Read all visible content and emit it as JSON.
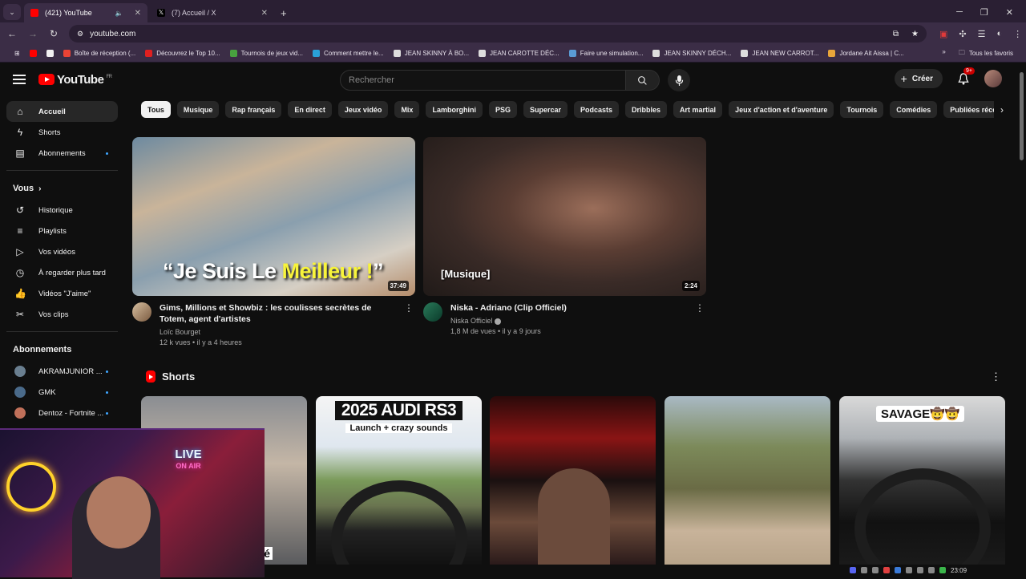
{
  "browser": {
    "tabs": [
      {
        "label": "(421) YouTube",
        "active": true,
        "color": "#ff0000"
      },
      {
        "label": "(7) Accueil / X",
        "active": false,
        "color": "#000000"
      }
    ],
    "url": "youtube.com",
    "bookmarks": [
      {
        "label": "Boîte de réception (...",
        "color": "#ea4335"
      },
      {
        "label": "Découvrez le Top 10...",
        "color": "#e02020"
      },
      {
        "label": "Tournois de jeux vid...",
        "color": "#48a23f"
      },
      {
        "label": "Comment mettre le...",
        "color": "#2aa1d8"
      },
      {
        "label": "JEAN SKINNY À BO...",
        "color": "#dddddd"
      },
      {
        "label": "JEAN CAROTTE DÉC...",
        "color": "#dddddd"
      },
      {
        "label": "Faire une simulation...",
        "color": "#5a9bd4"
      },
      {
        "label": "JEAN SKINNY DÉCH...",
        "color": "#dddddd"
      },
      {
        "label": "JEAN NEW CARROT...",
        "color": "#dddddd"
      },
      {
        "label": "Jordane Ait Aissa | C...",
        "color": "#e8a53a"
      }
    ],
    "all_bookmarks": "Tous les favoris"
  },
  "header": {
    "logo_text": "YouTube",
    "logo_region": "FR",
    "search_placeholder": "Rechercher",
    "create_label": "Créer",
    "notifications_badge": "9+"
  },
  "sidebar": {
    "main": [
      {
        "label": "Accueil",
        "icon": "home-icon",
        "active": true
      },
      {
        "label": "Shorts",
        "icon": "shorts-icon"
      },
      {
        "label": "Abonnements",
        "icon": "subscriptions-icon",
        "dot": true
      }
    ],
    "you_heading": "Vous",
    "you": [
      {
        "label": "Historique",
        "icon": "history-icon"
      },
      {
        "label": "Playlists",
        "icon": "playlist-icon"
      },
      {
        "label": "Vos vidéos",
        "icon": "video-icon"
      },
      {
        "label": "À regarder plus tard",
        "icon": "clock-icon"
      },
      {
        "label": "Vidéos \"J'aime\"",
        "icon": "thumb-up-icon"
      },
      {
        "label": "Vos clips",
        "icon": "scissors-icon"
      }
    ],
    "subs_heading": "Abonnements",
    "subs": [
      {
        "label": "AKRAMJUNIOR ...",
        "color": "#6a7f90"
      },
      {
        "label": "GMK",
        "color": "#4a6a8a"
      },
      {
        "label": "Dentoz - Fortnite ...",
        "color": "#c0705a"
      }
    ]
  },
  "chips": [
    "Tous",
    "Musique",
    "Rap français",
    "En direct",
    "Jeux vidéo",
    "Mix",
    "Lamborghini",
    "PSG",
    "Supercar",
    "Podcasts",
    "Dribbles",
    "Art martial",
    "Jeux d'action et d'aventure",
    "Tournois",
    "Comédies",
    "Publiées récemment"
  ],
  "videos": [
    {
      "overlay_pre": "“Je Suis Le ",
      "overlay_hl": "Meilleur !",
      "overlay_post": "”",
      "duration": "37:49",
      "title": "Gims, Millions et Showbiz : les coulisses secrètes de Totem, agent d'artistes",
      "channel": "Loïc Bourget",
      "stats": "12 k vues • il y a 4 heures"
    },
    {
      "overlay_tag": "[Musique]",
      "duration": "2:24",
      "title": "Niska - Adriano (Clip Officiel)",
      "channel": "Niska Officiel",
      "stats": "1,8 M de vues • il y a 9 jours"
    }
  ],
  "shorts": {
    "heading": "Shorts",
    "items": [
      {
        "caption": "oisé"
      },
      {
        "title": "2025 AUDI RS3",
        "subtitle": "Launch + crazy sounds"
      },
      {},
      {},
      {
        "title": "SAVAGE🤠🤠"
      }
    ]
  },
  "webcam": {
    "sign_line1": "LIVE",
    "sign_line2": "ON AIR"
  },
  "taskbar": {
    "time": "23:09"
  }
}
